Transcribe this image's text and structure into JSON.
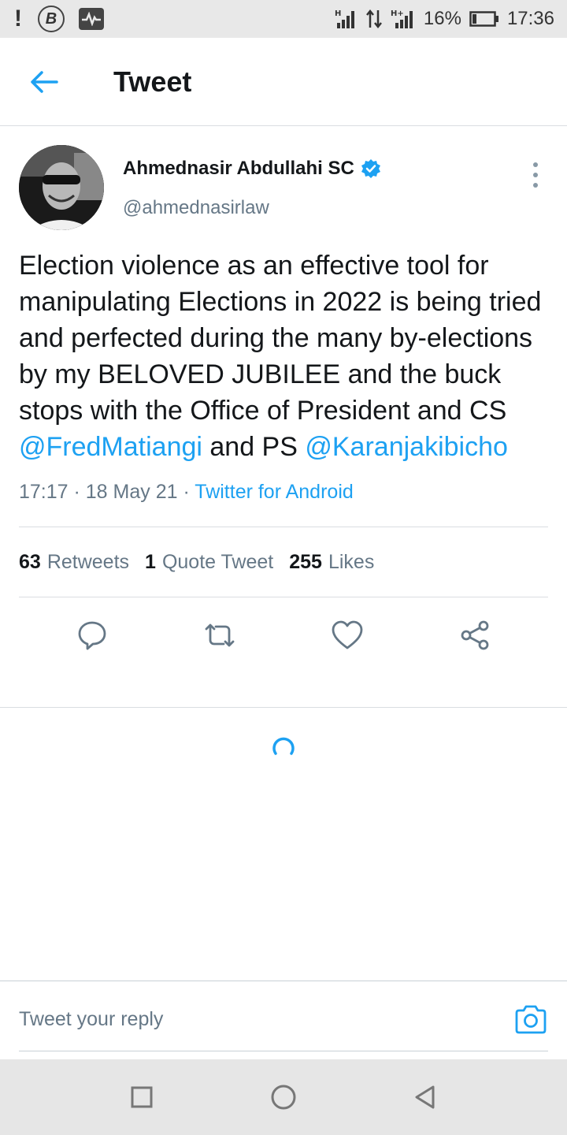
{
  "status_bar": {
    "network_1": "H",
    "network_2": "H+",
    "battery": "16%",
    "time": "17:36"
  },
  "header": {
    "title": "Tweet"
  },
  "tweet": {
    "author_name": "Ahmednasir Abdullahi SC",
    "author_handle": "@ahmednasirlaw",
    "text_part1": "Election violence as an effective tool for manipulating Elections in 2022 is being tried and perfected during the many by-elections by my BELOVED JUBILEE and the buck stops with the Office of President and CS ",
    "mention1": "@FredMatiangi",
    "text_part2": " and PS ",
    "mention2": "@Karanjakibicho",
    "time": "17:17",
    "date": "18 May 21",
    "source": "Twitter for Android",
    "separator": " · "
  },
  "stats": {
    "retweets_count": "63",
    "retweets_label": "Retweets",
    "quotes_count": "1",
    "quotes_label": "Quote Tweet",
    "likes_count": "255",
    "likes_label": "Likes"
  },
  "actions": [
    "reply-icon",
    "retweet-icon",
    "like-icon",
    "share-icon"
  ],
  "reply": {
    "placeholder": "Tweet your reply"
  },
  "colors": {
    "accent": "#1da1f2",
    "text": "#14171a",
    "secondary": "#657786"
  }
}
